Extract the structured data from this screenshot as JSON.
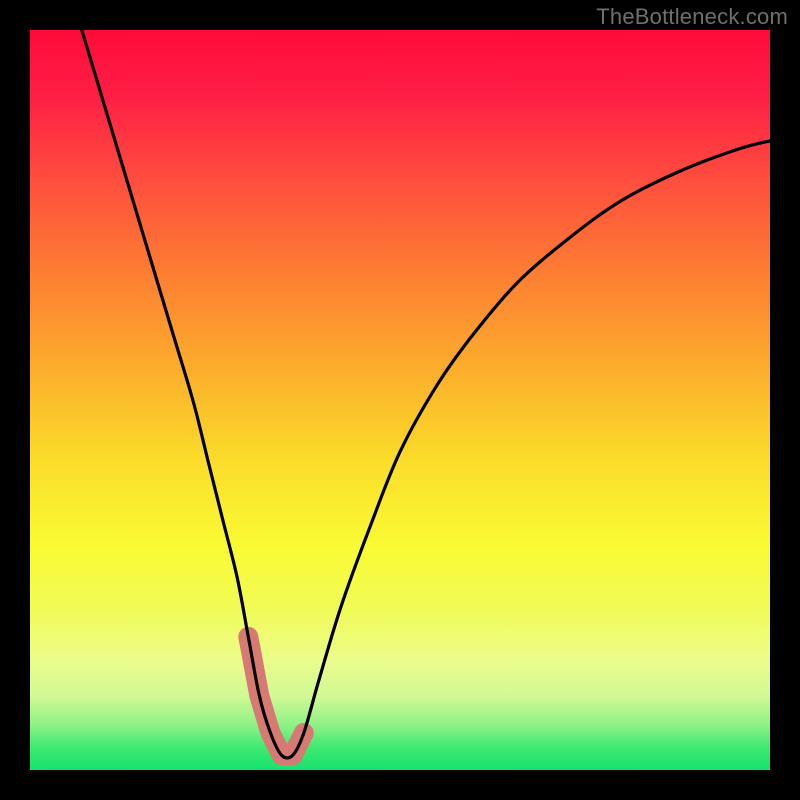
{
  "watermark": "TheBottleneck.com",
  "chart_data": {
    "type": "line",
    "title": "",
    "xlabel": "",
    "ylabel": "",
    "x_range": [
      0,
      100
    ],
    "y_range": [
      0,
      100
    ],
    "series": [
      {
        "name": "curve",
        "x": [
          7,
          10,
          13,
          16,
          19,
          22,
          24,
          26,
          28,
          29.5,
          31,
          32.5,
          34,
          35.5,
          37,
          39,
          42,
          46,
          50,
          55,
          60,
          66,
          73,
          80,
          88,
          96,
          100
        ],
        "y": [
          100,
          90,
          80,
          70,
          60,
          50,
          42,
          34,
          26,
          18,
          10,
          5,
          2,
          2,
          5,
          12,
          22,
          33,
          43,
          52,
          59,
          66,
          72,
          77,
          81,
          84,
          85
        ]
      }
    ],
    "highlight_segment": {
      "from_x": 29.5,
      "to_x": 37,
      "description": "minimum region emphasized"
    },
    "background_gradient_stops": [
      {
        "offset": 0.0,
        "color": "#ff0a3a"
      },
      {
        "offset": 0.09,
        "color": "#ff1f45"
      },
      {
        "offset": 0.2,
        "color": "#ff4c3e"
      },
      {
        "offset": 0.33,
        "color": "#fd7e32"
      },
      {
        "offset": 0.46,
        "color": "#fbae2b"
      },
      {
        "offset": 0.58,
        "color": "#fbdc2a"
      },
      {
        "offset": 0.7,
        "color": "#f9fb34"
      },
      {
        "offset": 0.78,
        "color": "#f1fb55"
      },
      {
        "offset": 0.85,
        "color": "#ecfc8a"
      },
      {
        "offset": 0.9,
        "color": "#d1f995"
      },
      {
        "offset": 0.94,
        "color": "#8df285"
      },
      {
        "offset": 0.97,
        "color": "#3de973"
      },
      {
        "offset": 1.0,
        "color": "#16e36e"
      }
    ]
  }
}
